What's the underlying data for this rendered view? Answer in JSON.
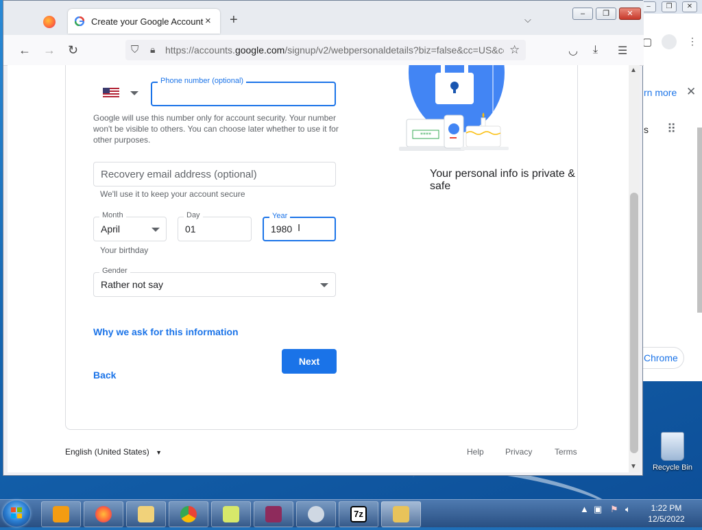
{
  "browser": {
    "tab_title": "Create your Google Account",
    "tab_close": "×",
    "new_tab": "+",
    "url_prefix": "https://accounts.",
    "url_host": "google.com",
    "url_rest": "/signup/v2/webpersonaldetails?biz=false&cc=US&cc"
  },
  "form": {
    "phone_label": "Phone number (optional)",
    "phone_value": "",
    "phone_helper": "Google will use this number only for account security. Your number won't be visible to others. You can choose later whether to use it for other purposes.",
    "recovery_placeholder": "Recovery email address (optional)",
    "recovery_helper": "We'll use it to keep your account secure",
    "month_label": "Month",
    "month_value": "April",
    "day_label": "Day",
    "day_value": "01",
    "year_label": "Year",
    "year_value": "1980",
    "birthday_helper": "Your birthday",
    "gender_label": "Gender",
    "gender_value": "Rather not say",
    "why_link": "Why we ask for this information",
    "back": "Back",
    "next": "Next"
  },
  "illustration": {
    "caption": "Your personal info is private & safe",
    "card_text": "****"
  },
  "footer": {
    "language": "English (United States)",
    "help": "Help",
    "privacy": "Privacy",
    "terms": "Terms"
  },
  "background_window": {
    "learn_more": "rn more",
    "fragment_s": "s",
    "chrome": "Chrome"
  },
  "desktop": {
    "recycle_bin": "Recycle Bin"
  },
  "taskbar": {
    "time": "1:22 PM",
    "date": "12/5/2022",
    "sevenzip": "7z"
  },
  "colors": {
    "accent": "#1a73e8",
    "illustration_blue": "#4285f4"
  }
}
